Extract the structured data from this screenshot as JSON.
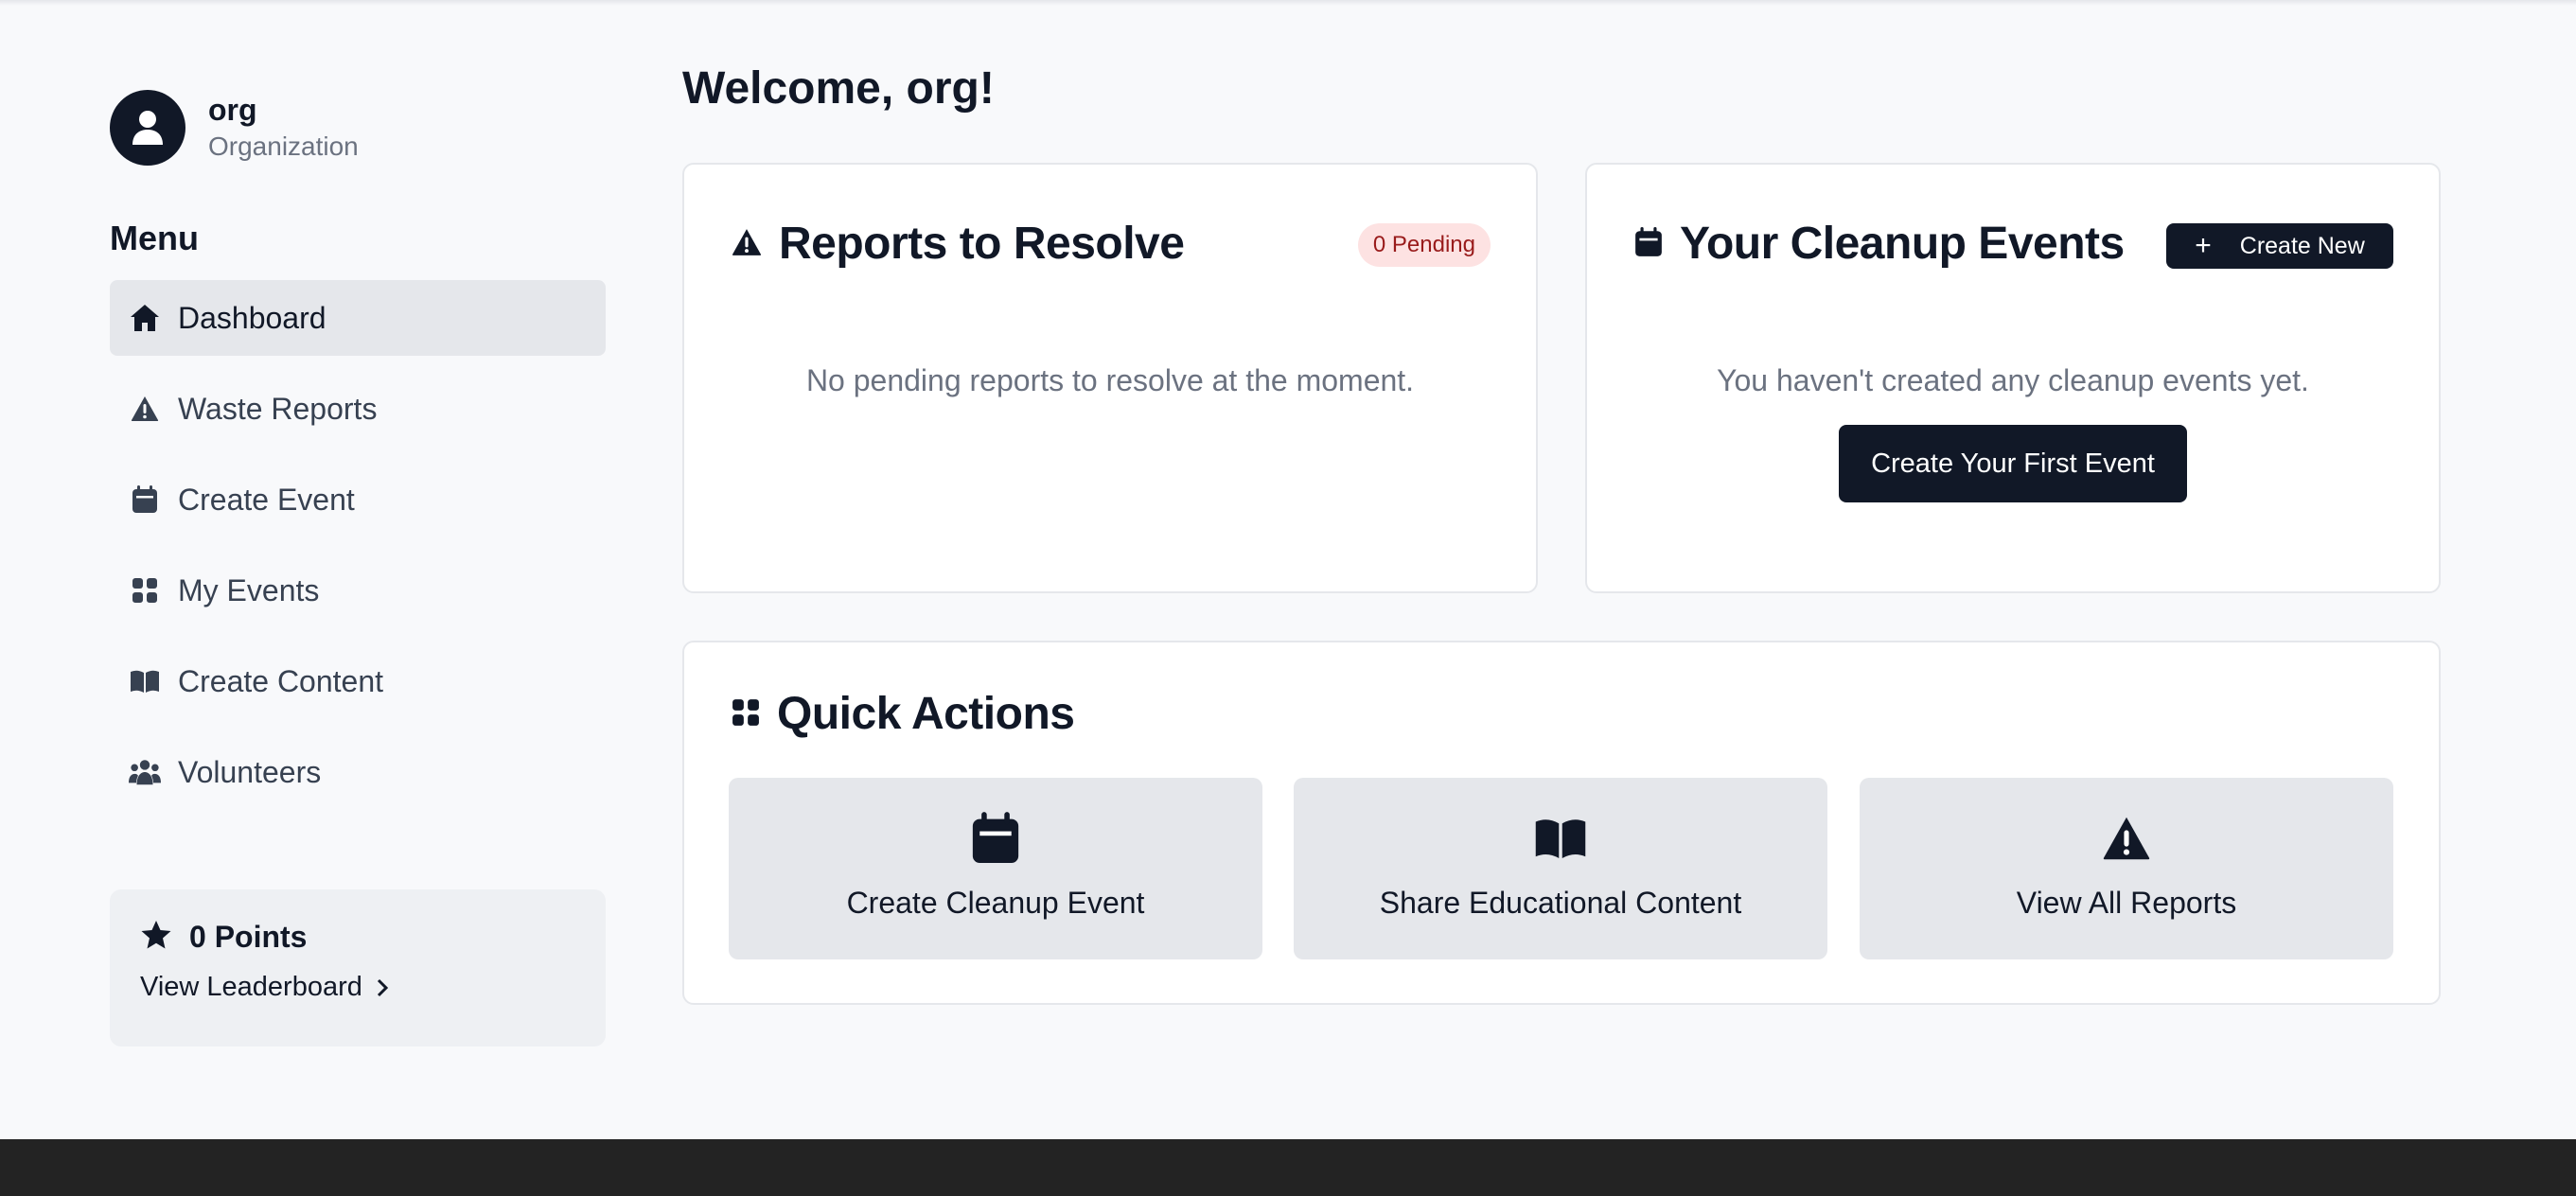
{
  "user": {
    "name": "org",
    "role": "Organization"
  },
  "sidebar": {
    "menu_title": "Menu",
    "items": [
      {
        "label": "Dashboard",
        "icon": "home-icon",
        "active": true
      },
      {
        "label": "Waste Reports",
        "icon": "warning-icon"
      },
      {
        "label": "Create Event",
        "icon": "calendar-icon"
      },
      {
        "label": "My Events",
        "icon": "grid-icon"
      },
      {
        "label": "Create Content",
        "icon": "book-icon"
      },
      {
        "label": "Volunteers",
        "icon": "users-icon"
      }
    ],
    "points": {
      "label": "0 Points",
      "link": "View Leaderboard"
    }
  },
  "main": {
    "welcome": "Welcome, org!",
    "reports": {
      "title": "Reports to Resolve",
      "badge": "0 Pending",
      "empty": "No pending reports to resolve at the moment."
    },
    "events": {
      "title": "Your Cleanup Events",
      "create_new_icon": "+",
      "create_new": "Create New",
      "empty": "You haven't created any cleanup events yet.",
      "first_event": "Create Your First Event"
    },
    "quick_actions": {
      "title": "Quick Actions",
      "tiles": [
        {
          "label": "Create Cleanup Event",
          "icon": "calendar-icon"
        },
        {
          "label": "Share Educational Content",
          "icon": "book-icon"
        },
        {
          "label": "View All Reports",
          "icon": "warning-icon"
        }
      ]
    }
  },
  "colors": {
    "primary": "#111827",
    "badge_bg": "#fde2e2",
    "badge_text": "#991b1b",
    "footer": "#232323"
  }
}
